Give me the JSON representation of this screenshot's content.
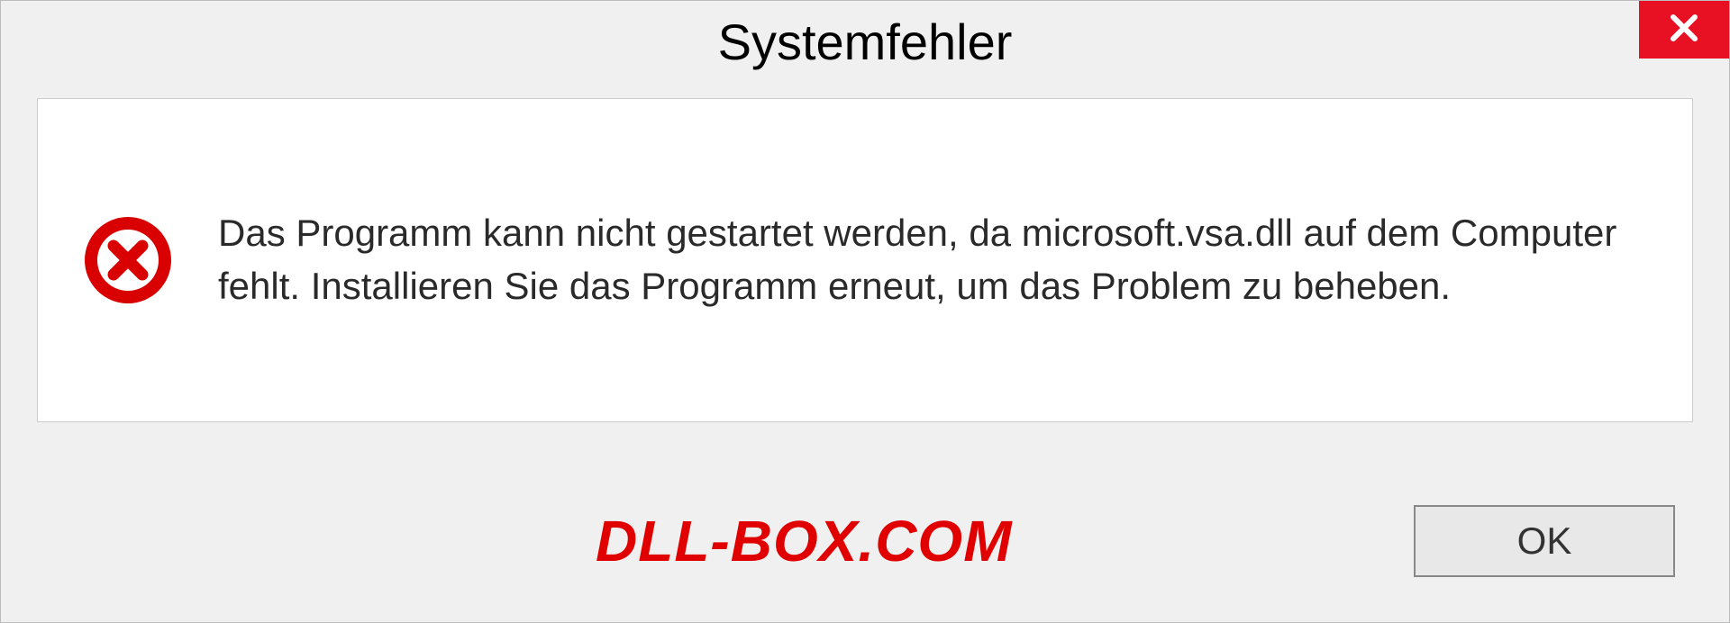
{
  "dialog": {
    "title": "Systemfehler",
    "message": "Das Programm kann nicht gestartet werden, da microsoft.vsa.dll auf dem Computer fehlt. Installieren Sie das Programm erneut, um das Problem zu beheben.",
    "ok_label": "OK"
  },
  "watermark": "DLL-BOX.COM",
  "colors": {
    "close_bg": "#e81123",
    "error_icon": "#d80000",
    "watermark": "#e00000"
  }
}
